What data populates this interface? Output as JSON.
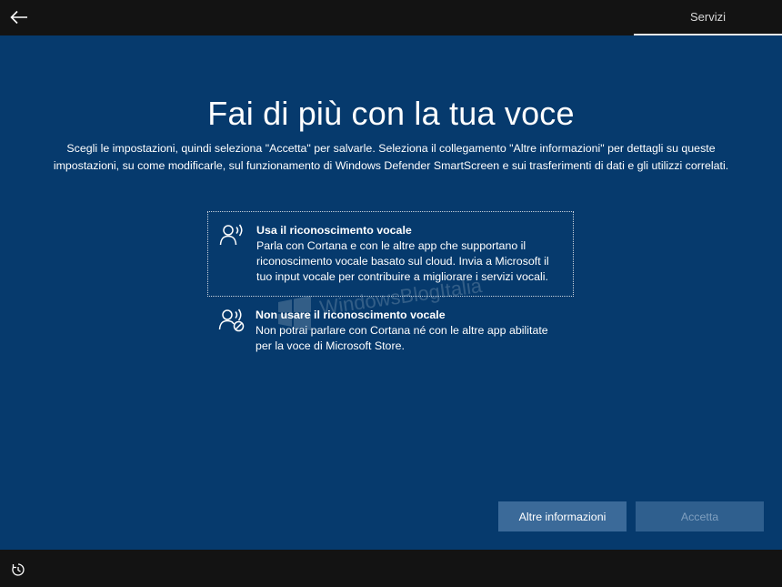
{
  "header": {
    "back_icon": "back-arrow-icon",
    "tab_label": "Servizi"
  },
  "main": {
    "title": "Fai di più con la tua voce",
    "description": "Scegli le impostazioni, quindi seleziona \"Accetta\" per salvarle. Seleziona il collegamento \"Altre informazioni\" per dettagli su queste impostazioni, su come modificarle, sul funzionamento di Windows Defender SmartScreen e sui trasferimenti di dati e gli utilizzi correlati.",
    "options": [
      {
        "icon": "speech-recognition-icon",
        "title": "Usa il riconoscimento vocale",
        "text": "Parla con Cortana e con le altre app che supportano il riconoscimento vocale basato sul cloud. Invia a Microsoft il tuo input vocale per contribuire a migliorare i servizi vocali.",
        "selected": true
      },
      {
        "icon": "speech-recognition-off-icon",
        "title": "Non usare il riconoscimento vocale",
        "text": "Non potrai parlare con Cortana né con le altre app abilitate per la voce di Microsoft Store.",
        "selected": false
      }
    ],
    "watermark": "WindowsBlogItalia"
  },
  "footer": {
    "more_info_label": "Altre informazioni",
    "accept_label": "Accetta",
    "ease_of_access_icon": "ease-of-access-icon"
  },
  "colors": {
    "background": "#063a6d",
    "bar": "#131313",
    "button": "#3b6a99",
    "button_disabled": "#2f5f8e"
  }
}
